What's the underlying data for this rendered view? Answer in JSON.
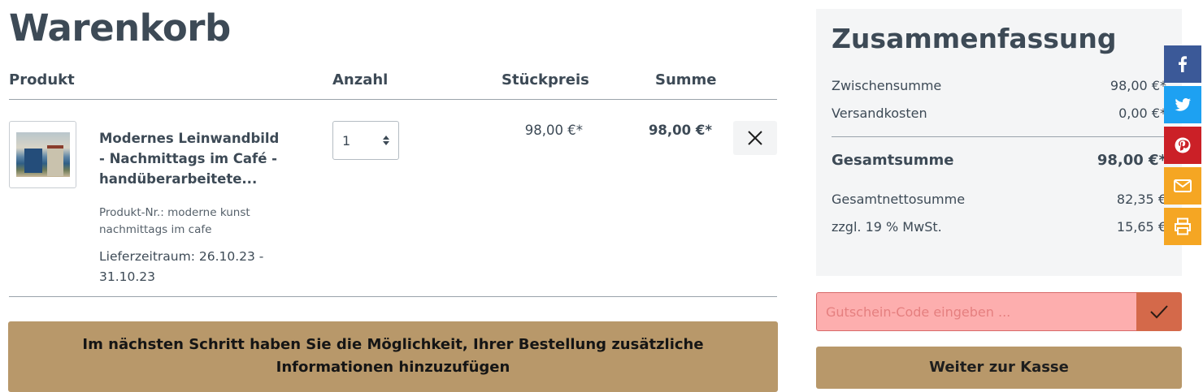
{
  "page": {
    "title": "Warenkorb"
  },
  "table": {
    "headers": {
      "product": "Produkt",
      "quantity": "Anzahl",
      "unit_price": "Stückpreis",
      "sum": "Summe"
    }
  },
  "item": {
    "name": "Modernes Leinwandbild - Nachmittags im Café - handüberarbeitete...",
    "product_number": "Produkt-Nr.: moderne kunst nachmittags im cafe",
    "delivery": "Lieferzeitraum: 26.10.23 - 31.10.23",
    "quantity": "1",
    "unit_price": "98,00 €*",
    "sum": "98,00 €*"
  },
  "info_banner": "Im nächsten Schritt haben Sie die Möglichkeit, Ihrer Bestellung zusätzliche Informationen hinzuzufügen",
  "summary": {
    "title": "Zusammenfassung",
    "subtotal_label": "Zwischensumme",
    "subtotal_value": "98,00 €*",
    "shipping_label": "Versandkosten",
    "shipping_value": "0,00 €*",
    "total_label": "Gesamtsumme",
    "total_value": "98,00 €*",
    "net_label": "Gesamtnettosumme",
    "net_value": "82,35 €",
    "tax_label": "zzgl. 19 % MwSt.",
    "tax_value": "15,65 €"
  },
  "coupon": {
    "placeholder": "Gutschein-Code eingeben ..."
  },
  "checkout": {
    "label": "Weiter zur Kasse"
  },
  "share_bar": {
    "items": [
      {
        "icon": "facebook-icon",
        "color": "#3b5998"
      },
      {
        "icon": "twitter-icon",
        "color": "#1da1f2"
      },
      {
        "icon": "pinterest-icon",
        "color": "#cb2027"
      },
      {
        "icon": "email-icon",
        "color": "#f5a623"
      },
      {
        "icon": "print-icon",
        "color": "#f5a623"
      }
    ]
  },
  "colors": {
    "accent": "#b8986a",
    "coupon_error_bg": "#fdaeae",
    "coupon_button": "#d4694a"
  }
}
